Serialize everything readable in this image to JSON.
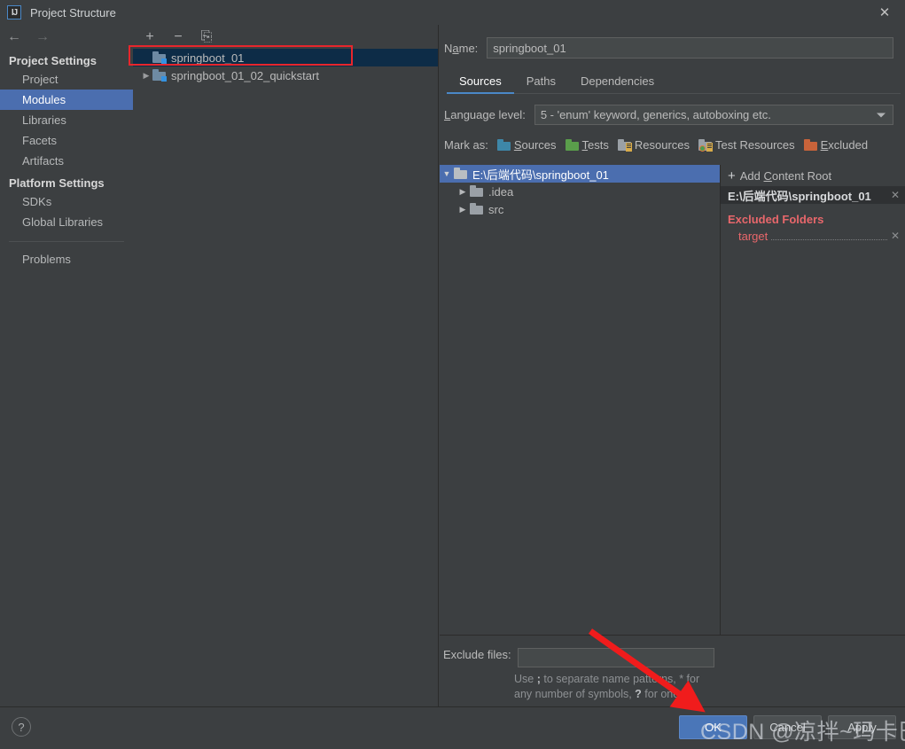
{
  "window": {
    "title": "Project Structure",
    "app_icon": "IJ",
    "close_label": "✕"
  },
  "navigation": {
    "back_icon": "←",
    "forward_icon": "→"
  },
  "sidebar": {
    "groups": [
      {
        "label": "Project Settings",
        "items": [
          {
            "label": "Project",
            "selected": false
          },
          {
            "label": "Modules",
            "selected": true
          },
          {
            "label": "Libraries",
            "selected": false
          },
          {
            "label": "Facets",
            "selected": false
          },
          {
            "label": "Artifacts",
            "selected": false
          }
        ]
      },
      {
        "label": "Platform Settings",
        "items": [
          {
            "label": "SDKs",
            "selected": false
          },
          {
            "label": "Global Libraries",
            "selected": false
          }
        ]
      }
    ],
    "problems_label": "Problems"
  },
  "module_list": {
    "toolbar": {
      "add_label": "+",
      "remove_label": "−",
      "copy_label": "⎘"
    },
    "rows": [
      {
        "label": "springboot_01",
        "selected": true,
        "expandable": false,
        "twisty": ""
      },
      {
        "label": "springboot_01_02_quickstart",
        "selected": false,
        "expandable": true,
        "twisty": "▶"
      }
    ]
  },
  "detail": {
    "name_label": "Name:",
    "name_value": "springboot_01",
    "tabs": [
      {
        "label": "Sources",
        "active": true
      },
      {
        "label": "Paths",
        "active": false
      },
      {
        "label": "Dependencies",
        "active": false
      }
    ],
    "language_level_label": "Language level:",
    "language_level_value": "5 - 'enum' keyword, generics, autoboxing etc.",
    "mark_as_label": "Mark as:",
    "mark_as_options": [
      {
        "label": "Sources",
        "color": "#3e87a8"
      },
      {
        "label": "Tests",
        "color": "#5a9e4b"
      },
      {
        "label": "Resources",
        "color": "#9aa0a6"
      },
      {
        "label": "Test Resources",
        "color": "#9aa0a6"
      },
      {
        "label": "Excluded",
        "color": "#c8633a"
      }
    ],
    "content_tree": [
      {
        "label": "E:\\后端代码\\springboot_01",
        "depth": 0,
        "twisty": "▼",
        "selected": true
      },
      {
        "label": ".idea",
        "depth": 1,
        "twisty": "▶",
        "selected": false
      },
      {
        "label": "src",
        "depth": 1,
        "twisty": "▶",
        "selected": false
      }
    ],
    "rail": {
      "add_content_root_label": "Add Content Root",
      "add_icon": "+",
      "root_path": "E:\\后端代码\\springboot_01",
      "root_remove_icon": "✕",
      "excluded_folders_label": "Excluded Folders",
      "excluded_items": [
        {
          "label": "target",
          "remove_icon": "✕"
        }
      ]
    },
    "exclude_files_label": "Exclude files:",
    "exclude_files_value": "",
    "exclude_files_hint_line1_pre": "Use ",
    "exclude_files_hint_sep": ";",
    "exclude_files_hint_line1_post": " to separate name patterns, * for",
    "exclude_files_hint_line2_pre": "any number of symbols, ",
    "exclude_files_hint_q": "?",
    "exclude_files_hint_line2_post": " for one."
  },
  "bottom_bar": {
    "help_label": "?",
    "buttons": [
      {
        "label": "OK",
        "primary": true
      },
      {
        "label": "Cancel",
        "primary": false
      },
      {
        "label": "Apply",
        "primary": false
      }
    ]
  },
  "annotations": {
    "watermark": "CSDN @凉拌~玛卡巴卡",
    "highlight_color": "#e8262c",
    "arrow_color": "#f01c1c"
  }
}
